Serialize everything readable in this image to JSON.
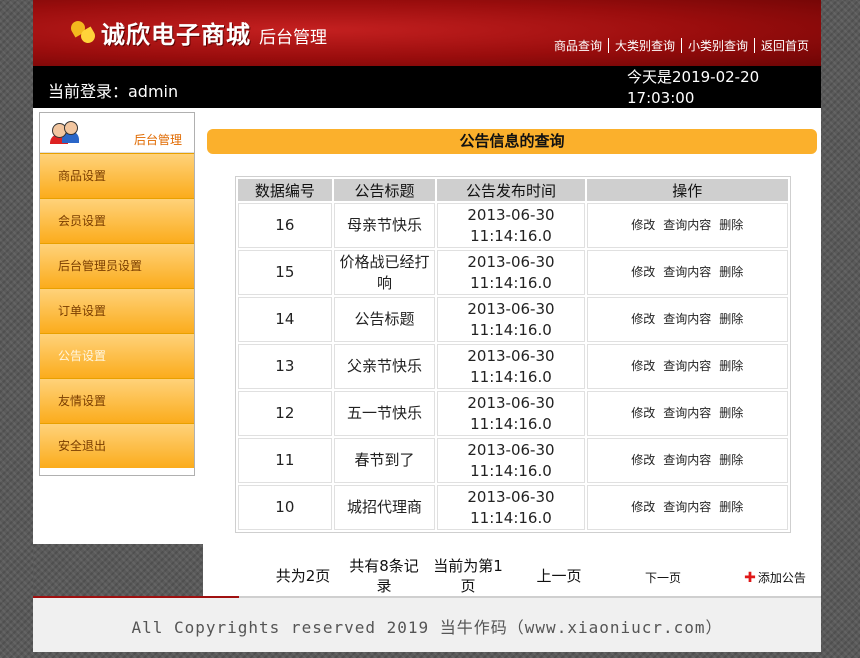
{
  "header": {
    "brand": "诚欣电子商城",
    "subtitle": "后台管理",
    "nav": [
      "商品查询",
      "大类别查询",
      "小类别查询",
      "返回首页"
    ]
  },
  "userbar": {
    "login": "当前登录：admin",
    "today_line1": "今天是2019-02-20",
    "today_line2": "17:03:00"
  },
  "sidebar": {
    "title": "后台管理",
    "items": [
      "商品设置",
      "会员设置",
      "后台管理员设置",
      "订单设置",
      "公告设置",
      "友情设置",
      "安全退出"
    ],
    "active_index": 4
  },
  "main": {
    "title": "公告信息的查询",
    "columns": [
      "数据编号",
      "公告标题",
      "公告发布时间",
      "操作"
    ],
    "ops": {
      "edit": "修改",
      "view": "查询内容",
      "delete": "删除"
    },
    "rows": [
      {
        "id": "16",
        "title": "母亲节快乐",
        "date": "2013-06-30",
        "time": "11:14:16.0"
      },
      {
        "id": "15",
        "title": "价格战已经打响",
        "date": "2013-06-30",
        "time": "11:14:16.0"
      },
      {
        "id": "14",
        "title": "公告标题",
        "date": "2013-06-30",
        "time": "11:14:16.0"
      },
      {
        "id": "13",
        "title": "父亲节快乐",
        "date": "2013-06-30",
        "time": "11:14:16.0"
      },
      {
        "id": "12",
        "title": "五一节快乐",
        "date": "2013-06-30",
        "time": "11:14:16.0"
      },
      {
        "id": "11",
        "title": "春节到了",
        "date": "2013-06-30",
        "time": "11:14:16.0"
      },
      {
        "id": "10",
        "title": "城招代理商",
        "date": "2013-06-30",
        "time": "11:14:16.0"
      }
    ]
  },
  "pager": {
    "total_pages": "共为2页",
    "total_records": "共有8条记录",
    "current_page": "当前为第1页",
    "prev": "上一页",
    "next": "下一页",
    "add": "添加公告"
  },
  "footer": {
    "copyright": "All Copyrights reserved 2019 当牛作码（www.xiaoniucr.com）"
  },
  "colors": {
    "header_red": "#9a0d0d",
    "accent_orange": "#fbb02c"
  }
}
